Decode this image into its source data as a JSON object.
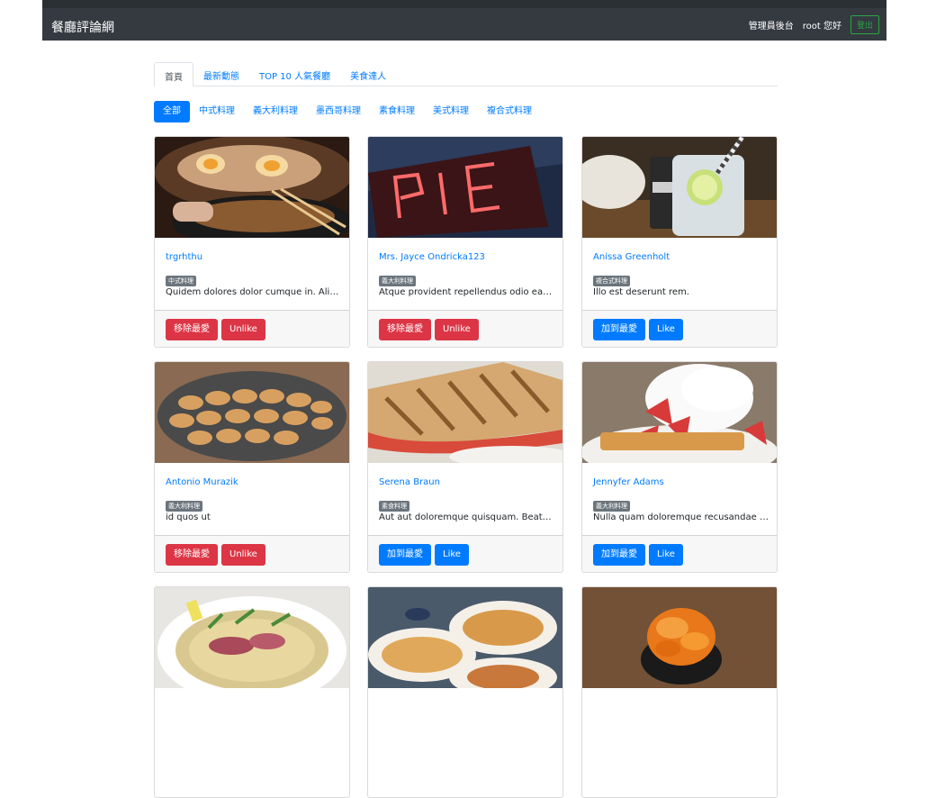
{
  "navbar": {
    "brand": "餐廳評論網",
    "admin_link": "管理員後台",
    "greeting": "root 您好",
    "logout": "登出"
  },
  "tabs": [
    {
      "label": "首頁",
      "active": true
    },
    {
      "label": "最新動態",
      "active": false
    },
    {
      "label": "TOP 10 人氣餐廳",
      "active": false
    },
    {
      "label": "美食達人",
      "active": false
    }
  ],
  "categories": [
    {
      "label": "全部",
      "active": true
    },
    {
      "label": "中式料理",
      "active": false
    },
    {
      "label": "義大利料理",
      "active": false
    },
    {
      "label": "墨西哥料理",
      "active": false
    },
    {
      "label": "素食料理",
      "active": false
    },
    {
      "label": "美式料理",
      "active": false
    },
    {
      "label": "複合式料理",
      "active": false
    }
  ],
  "restaurants": [
    {
      "name": "trgrhthu",
      "category": "中式料理",
      "description": "Quidem dolores dolor cumque in. Aliquid…",
      "favorite_button": "移除最愛",
      "favorited": true,
      "like_button": "Unlike",
      "liked": true,
      "image_alt": "noodle-soup"
    },
    {
      "name": "Mrs. Jayce Ondricka123",
      "category": "義大利料理",
      "description": "Atque provident repellendus odio earum.",
      "favorite_button": "移除最愛",
      "favorited": true,
      "like_button": "Unlike",
      "liked": true,
      "image_alt": "pie-neon-sign"
    },
    {
      "name": "Anissa Greenholt",
      "category": "複合式料理",
      "description": "Illo est deserunt rem.",
      "favorite_button": "加到最愛",
      "favorited": false,
      "like_button": "Like",
      "liked": false,
      "image_alt": "lemon-drink"
    },
    {
      "name": "Antonio Murazik",
      "category": "義大利料理",
      "description": "id quos ut",
      "favorite_button": "移除最愛",
      "favorited": true,
      "like_button": "Unlike",
      "liked": true,
      "image_alt": "egg-tarts"
    },
    {
      "name": "Serena Braun",
      "category": "素食料理",
      "description": "Aut aut doloremque quisquam. Beatae au…",
      "favorite_button": "加到最愛",
      "favorited": false,
      "like_button": "Like",
      "liked": false,
      "image_alt": "panini"
    },
    {
      "name": "Jennyfer Adams",
      "category": "義大利料理",
      "description": "Nulla quam doloremque recusandae labo…",
      "favorite_button": "加到最愛",
      "favorited": false,
      "like_button": "Like",
      "liked": false,
      "image_alt": "waffle-cream"
    },
    {
      "name": "",
      "category": "",
      "description": "",
      "favorite_button": "",
      "favorited": false,
      "like_button": "",
      "liked": false,
      "image_alt": "ramen-bowl"
    },
    {
      "name": "",
      "category": "",
      "description": "",
      "favorite_button": "",
      "favorited": false,
      "like_button": "",
      "liked": false,
      "image_alt": "fried-food-table"
    },
    {
      "name": "",
      "category": "",
      "description": "",
      "favorite_button": "",
      "favorited": false,
      "like_button": "",
      "liked": false,
      "image_alt": "uni-sushi"
    }
  ],
  "colors": {
    "navbar": "#343a40",
    "primary": "#007bff",
    "danger": "#dc3545",
    "success": "#28a745",
    "badge": "#6c757d"
  }
}
